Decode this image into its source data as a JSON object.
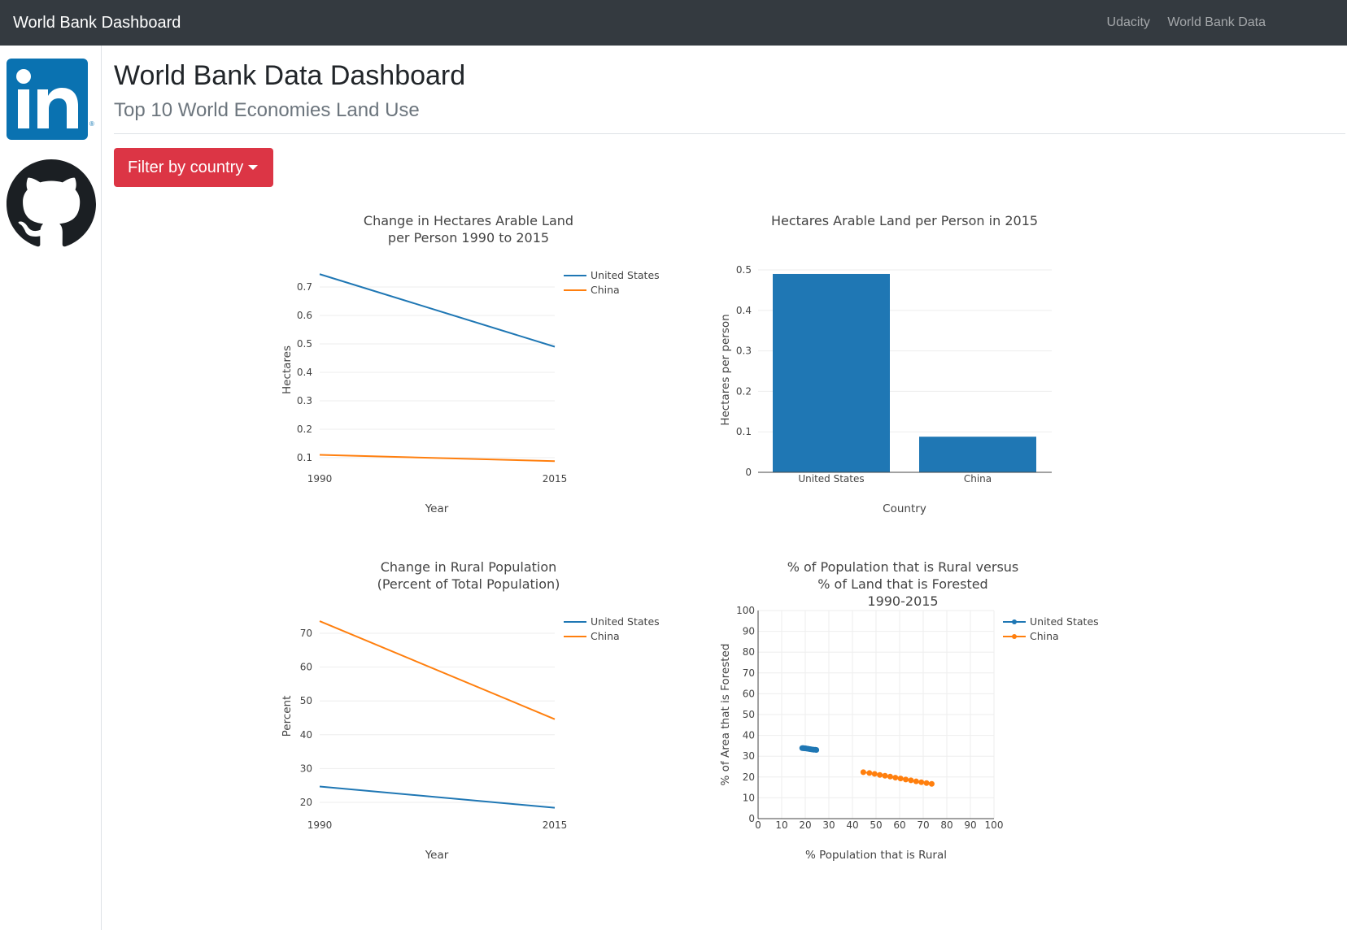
{
  "navbar": {
    "brand": "World Bank Dashboard",
    "links": [
      "Udacity",
      "World Bank Data"
    ]
  },
  "sidebar": {
    "icons": [
      "linkedin-icon",
      "github-icon"
    ]
  },
  "header": {
    "title": "World Bank Data Dashboard",
    "subtitle": "Top 10 World Economies Land Use"
  },
  "filter": {
    "label": "Filter by country"
  },
  "colors": {
    "us": "#1f77b4",
    "china": "#ff7f0e",
    "button": "#dc3545",
    "navbar": "#343a40"
  },
  "chart_data": [
    {
      "type": "line",
      "title": [
        "Change in Hectares Arable Land",
        "per Person 1990 to 2015"
      ],
      "xlabel": "Year",
      "ylabel": "Hectares",
      "x": [
        "1990",
        "2015"
      ],
      "series": [
        {
          "name": "United States",
          "values": [
            0.745,
            0.49
          ]
        },
        {
          "name": "China",
          "values": [
            0.11,
            0.088
          ]
        }
      ],
      "yticks": [
        "0.1",
        "0.2",
        "0.3",
        "0.4",
        "0.5",
        "0.6",
        "0.7"
      ],
      "ylim": [
        0.088,
        0.745
      ],
      "legend": "top-right"
    },
    {
      "type": "bar",
      "title": [
        "Hectares Arable Land per Person in 2015"
      ],
      "xlabel": "Country",
      "ylabel": "Hectares per person",
      "categories": [
        "United States",
        "China"
      ],
      "values": [
        0.49,
        0.088
      ],
      "yticks": [
        "0",
        "0.1",
        "0.2",
        "0.3",
        "0.4",
        "0.5"
      ],
      "ylim": [
        0,
        0.5
      ]
    },
    {
      "type": "line",
      "title": [
        "Change in Rural Population",
        "(Percent of Total Population)"
      ],
      "xlabel": "Year",
      "ylabel": "Percent",
      "x": [
        "1990",
        "2015"
      ],
      "series": [
        {
          "name": "United States",
          "values": [
            24.7,
            18.4
          ]
        },
        {
          "name": "China",
          "values": [
            73.6,
            44.6
          ]
        }
      ],
      "yticks": [
        "20",
        "30",
        "40",
        "50",
        "60",
        "70"
      ],
      "ylim": [
        18.4,
        73.6
      ],
      "legend": "top-right"
    },
    {
      "type": "scatter",
      "title": [
        "% of Population that is Rural versus",
        "% of Land that is Forested",
        "1990-2015"
      ],
      "xlabel": "% Population that is Rural",
      "ylabel": "% of Area that is Forested",
      "xticks": [
        "0",
        "10",
        "20",
        "30",
        "40",
        "50",
        "60",
        "70",
        "80",
        "90",
        "100"
      ],
      "yticks": [
        "0",
        "10",
        "20",
        "30",
        "40",
        "50",
        "60",
        "70",
        "80",
        "90",
        "100"
      ],
      "xlim": [
        0,
        100
      ],
      "ylim": [
        0,
        100
      ],
      "series": [
        {
          "name": "United States",
          "x": [
            24.7,
            24.2,
            23.6,
            23.1,
            22.5,
            22.0,
            21.5,
            21.0,
            20.5,
            20.0,
            19.6,
            19.3,
            19.0,
            18.7
          ],
          "y": [
            33.0,
            33.1,
            33.1,
            33.2,
            33.3,
            33.4,
            33.5,
            33.6,
            33.7,
            33.8,
            33.8,
            33.9,
            33.9,
            33.9
          ]
        },
        {
          "name": "China",
          "x": [
            73.6,
            71.4,
            69.2,
            67.0,
            64.8,
            62.6,
            60.4,
            58.2,
            56.0,
            53.8,
            51.6,
            49.4,
            47.2,
            44.6
          ],
          "y": [
            16.7,
            17.1,
            17.5,
            17.9,
            18.4,
            18.8,
            19.3,
            19.7,
            20.2,
            20.6,
            21.0,
            21.5,
            21.9,
            22.3
          ]
        }
      ],
      "grid": true,
      "legend": "top-right"
    }
  ]
}
